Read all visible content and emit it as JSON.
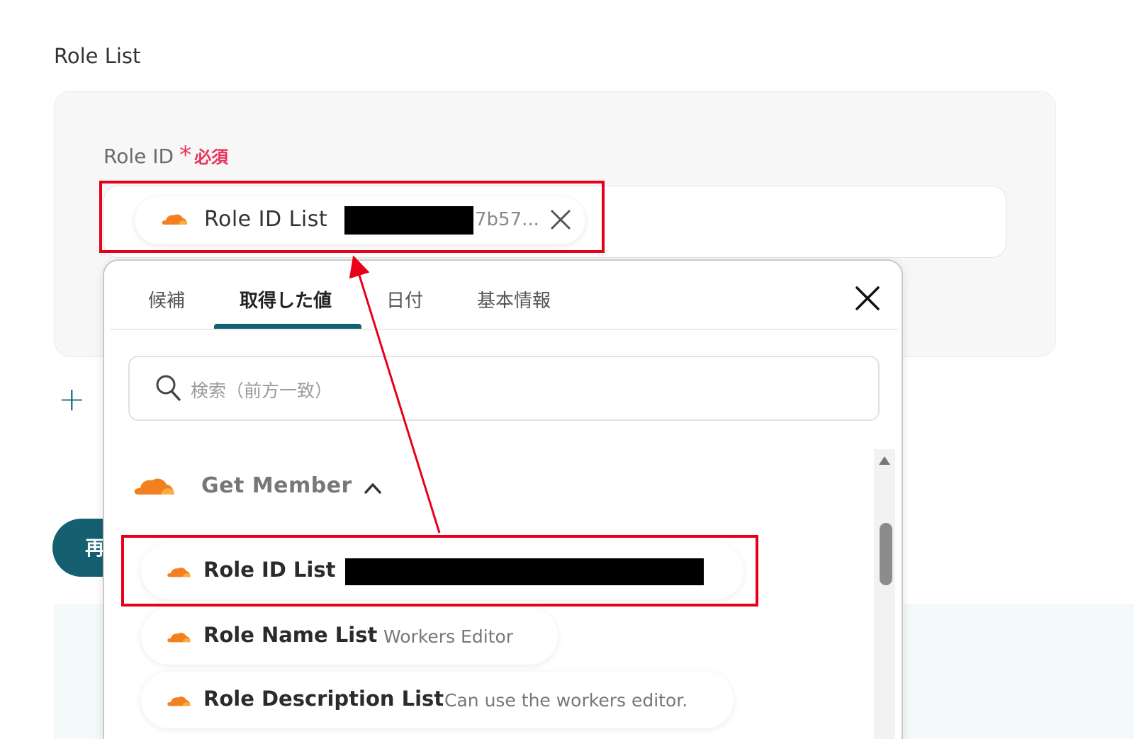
{
  "section_title": "Role List",
  "field": {
    "label": "Role ID",
    "required_mark": "*",
    "required_text": "必須",
    "chip_label": "Role ID List",
    "chip_value_tail": "7b57..."
  },
  "add_button": "+",
  "run_button": "再",
  "popup": {
    "tabs": [
      "候補",
      "取得した値",
      "日付",
      "基本情報"
    ],
    "active_tab": "取得した値",
    "search_placeholder": "検索（前方一致）",
    "group_title": "Get Member",
    "items": [
      {
        "title": "Role ID List",
        "subtitle": ""
      },
      {
        "title": "Role Name List",
        "subtitle": "Workers Editor"
      },
      {
        "title": "Role Description List",
        "subtitle": "Can use the workers editor."
      }
    ]
  },
  "colors": {
    "accent_teal": "#145f70",
    "required_red": "#e8335a",
    "highlight_red": "#e8001a",
    "cloud_orange": "#f38020"
  }
}
